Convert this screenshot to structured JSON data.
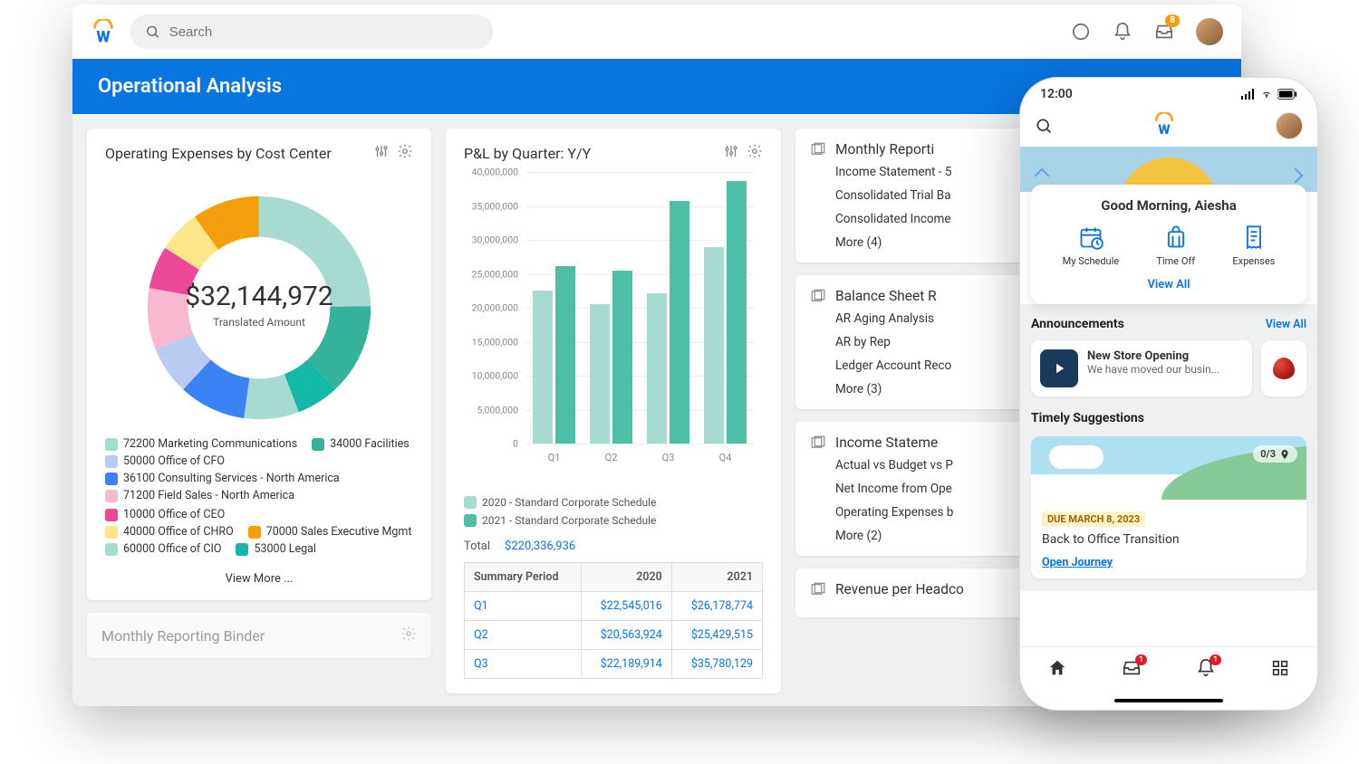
{
  "topbar": {
    "search_placeholder": "Search",
    "inbox_badge": "8"
  },
  "title": "Operational Analysis",
  "donut_card": {
    "title": "Operating Expenses by Cost Center",
    "amount": "$32,144,972",
    "sub": "Translated Amount",
    "view_more": "View More ...",
    "legend": [
      {
        "color": "#a7dbd2",
        "label": "72200 Marketing Communications"
      },
      {
        "color": "#34b39a",
        "label": "34000 Facilities"
      },
      {
        "color": "#b8cbf0",
        "label": "50000 Office of CFO"
      },
      {
        "color": "#3b82f6",
        "label": "36100 Consulting Services - North America"
      },
      {
        "color": "#f8b8d0",
        "label": "71200 Field Sales - North America"
      },
      {
        "color": "#ec4899",
        "label": "10000 Office of CEO"
      },
      {
        "color": "#fde68a",
        "label": "40000 Office of CHRO"
      },
      {
        "color": "#f59e0b",
        "label": "70000 Sales Executive Mgmt"
      },
      {
        "color": "#a7dbd2",
        "label": "60000 Office of CIO"
      },
      {
        "color": "#14b8a6",
        "label": "53000 Legal"
      }
    ]
  },
  "pl_card": {
    "title": "P&L by Quarter: Y/Y",
    "legend1": "2020 - Standard Corporate Schedule",
    "legend2": "2021 - Standard Corporate Schedule",
    "total_label": "Total",
    "total_value": "$220,336,936",
    "summary_header": "Summary Period",
    "col_2020": "2020",
    "col_2021": "2021",
    "rows": [
      {
        "q": "Q1",
        "v2020": "$22,545,016",
        "v2021": "$26,178,774"
      },
      {
        "q": "Q2",
        "v2020": "$20,563,924",
        "v2021": "$25,429,515"
      },
      {
        "q": "Q3",
        "v2020": "$22,189,914",
        "v2021": "$35,780,129"
      }
    ]
  },
  "chart_data": {
    "type": "bar",
    "title": "P&L by Quarter: Y/Y",
    "categories": [
      "Q1",
      "Q2",
      "Q3",
      "Q4"
    ],
    "series": [
      {
        "name": "2020 - Standard Corporate Schedule",
        "values": [
          22545016,
          20563924,
          22189914,
          29000000
        ]
      },
      {
        "name": "2021 - Standard Corporate Schedule",
        "values": [
          26178774,
          25429515,
          35780129,
          38700000
        ]
      }
    ],
    "ylabel": "",
    "ylim": [
      0,
      40000000
    ],
    "ystep": 5000000,
    "yticks": [
      "0",
      "5,000,000",
      "10,000,000",
      "15,000,000",
      "20,000,000",
      "25,000,000",
      "30,000,000",
      "35,000,000",
      "40,000,000"
    ]
  },
  "right": {
    "s1": {
      "title": "Monthly Reporti",
      "items": [
        "Income Statement - 5",
        "Consolidated Trial Ba",
        "Consolidated Income"
      ],
      "more": "More (4)"
    },
    "s2": {
      "title": "Balance Sheet R",
      "items": [
        "AR Aging Analysis",
        "AR by Rep",
        "Ledger Account Reco"
      ],
      "more": "More (3)"
    },
    "s3": {
      "title": "Income Stateme",
      "items": [
        "Actual vs Budget vs P",
        "Net Income from Ope",
        "Operating Expenses b"
      ],
      "more": "More (2)"
    },
    "s4": {
      "title": "Revenue per Headco"
    }
  },
  "binder": {
    "title": "Monthly Reporting Binder"
  },
  "mobile": {
    "time": "12:00",
    "greet": "Good Morning, Aiesha",
    "shortcuts": [
      {
        "label": "My Schedule"
      },
      {
        "label": "Time Off"
      },
      {
        "label": "Expenses"
      }
    ],
    "view_all": "View All",
    "announcements": "Announcements",
    "ann_title": "New Store Opening",
    "ann_sub": "We have moved our busin...",
    "timely": "Timely Suggestions",
    "progress": "0/3",
    "due": "DUE MARCH 8, 2023",
    "sugg_title": "Back to Office Transition",
    "open": "Open Journey",
    "inbox_badge": "1",
    "bell_badge": "1"
  }
}
